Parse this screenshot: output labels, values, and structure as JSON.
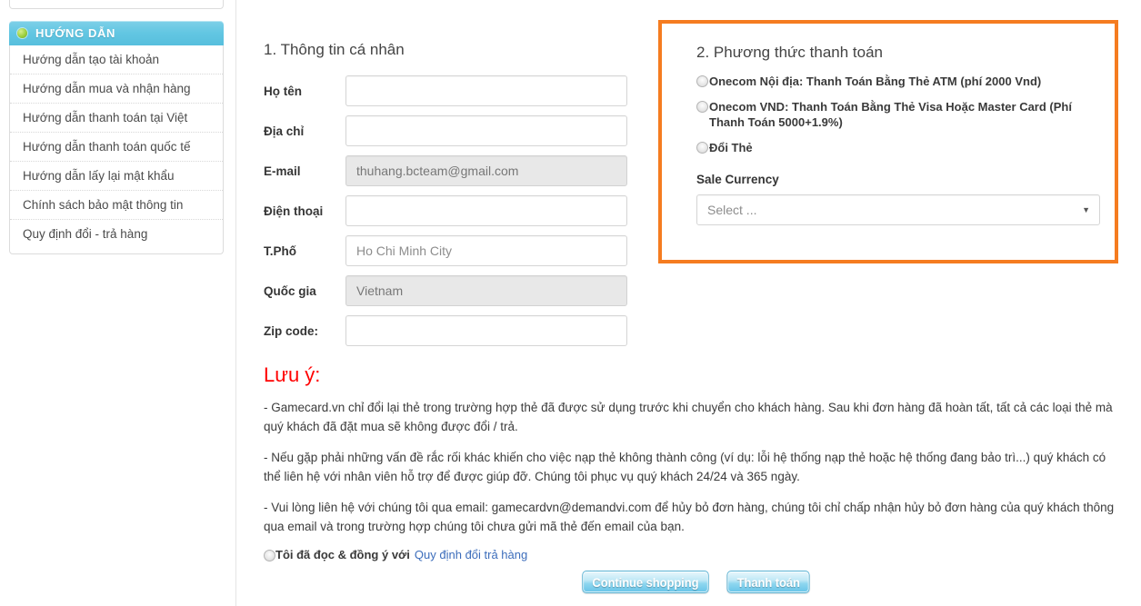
{
  "sidebar": {
    "header": {
      "icon": "green-dot-icon",
      "title": "HƯỚNG DẪN"
    },
    "items": [
      {
        "label": "Hướng dẫn tạo tài khoản"
      },
      {
        "label": "Hướng dẫn mua và nhận hàng"
      },
      {
        "label": "Hướng dẫn thanh toán tại Việt"
      },
      {
        "label": "Hướng dẫn thanh toán quốc tế"
      },
      {
        "label": "Hướng dẫn lấy lại mật khẩu"
      },
      {
        "label": "Chính sách bảo mật thông tin"
      },
      {
        "label": "Quy định đổi - trả hàng"
      }
    ]
  },
  "personal_info": {
    "title": "1. Thông tin cá nhân",
    "fields": [
      {
        "label": "Họ tên",
        "value": "",
        "placeholder": "",
        "disabled": false
      },
      {
        "label": "Địa chỉ",
        "value": "",
        "placeholder": "",
        "disabled": false
      },
      {
        "label": "E-mail",
        "value": "thuhang.bcteam@gmail.com",
        "placeholder": "",
        "disabled": true
      },
      {
        "label": "Điện thoại",
        "value": "",
        "placeholder": "",
        "disabled": false
      },
      {
        "label": "T.Phố",
        "value": "",
        "placeholder": "Ho Chi Minh City",
        "disabled": false
      },
      {
        "label": "Quốc gia",
        "value": "Vietnam",
        "placeholder": "",
        "disabled": true
      },
      {
        "label": "Zip code:",
        "value": "",
        "placeholder": "",
        "disabled": false
      }
    ]
  },
  "payment": {
    "title": "2. Phương thức thanh toán",
    "border_color": "#f57c20",
    "options": [
      {
        "label": "Onecom Nội địa: Thanh Toán Bằng Thẻ ATM (phí 2000 Vnd)",
        "selected": false
      },
      {
        "label": "Onecom VND: Thanh Toán Bằng Thẻ Visa Hoặc Master Card (Phí Thanh Toán 5000+1.9%)",
        "selected": false
      },
      {
        "label": "Đổi Thẻ",
        "selected": false
      }
    ],
    "currency": {
      "label": "Sale Currency",
      "selected_value": "Select ...",
      "arrow_icon": "chevron-down-icon"
    }
  },
  "notes": {
    "heading": "Lưu ý:",
    "heading_color": "#ff0000",
    "paragraphs": [
      "- Gamecard.vn chỉ đổi lại thẻ trong trường hợp thẻ đã được sử dụng trước khi chuyển cho khách hàng. Sau khi đơn hàng đã hoàn tất, tất cả các loại thẻ mà quý khách đã đặt mua sẽ không được đổi / trả.",
      "- Nếu gặp phải những vấn đề rắc rối khác khiến cho việc nạp thẻ không thành công (ví dụ: lỗi hệ thống nạp thẻ hoặc hệ thống đang bảo trì...) quý khách có thể liên hệ với nhân viên hỗ trợ để được giúp đỡ. Chúng tôi phục vụ quý khách 24/24 và 365 ngày.",
      "- Vui lòng liên hệ với chúng tôi qua email: gamecardvn@demandvi.com để hủy bỏ đơn hàng, chúng tôi chỉ chấp nhận hủy bỏ đơn hàng của quý khách thông qua email và trong trường hợp chúng tôi chưa gửi mã thẻ đến email của bạn."
    ],
    "agreement": {
      "text": "Tôi đã đọc & đồng ý với",
      "link_label": "Quy định đổi trả hàng",
      "link_color": "#3c6dbb",
      "selected": false
    }
  },
  "actions": {
    "continue_label": "Continue shopping",
    "checkout_label": "Thanh toán"
  }
}
